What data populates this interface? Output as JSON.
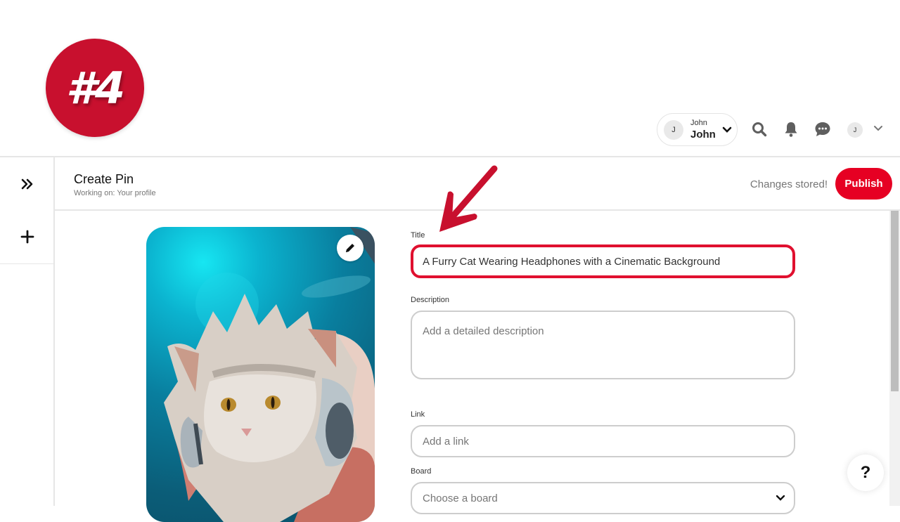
{
  "overlay": {
    "badge_text": "#4",
    "badge_color": "#c8102e",
    "arrow_color": "#c8102e"
  },
  "topbar": {
    "account": {
      "avatar_initial": "J",
      "name_small": "John",
      "name_large": "John"
    },
    "icons": [
      "search-icon",
      "bell-icon",
      "chat-icon"
    ],
    "profile_avatar_initial": "J"
  },
  "sidebar": {
    "items": [
      {
        "icon": "expand-icon",
        "label": "»"
      },
      {
        "icon": "plus-icon",
        "label": "+"
      }
    ]
  },
  "header": {
    "title": "Create Pin",
    "subtitle": "Working on: Your profile",
    "status": "Changes stored!",
    "publish_label": "Publish",
    "accent": "#e60023"
  },
  "form": {
    "title": {
      "label": "Title",
      "value": "A Furry Cat Wearing Headphones with a Cinematic Background"
    },
    "description": {
      "label": "Description",
      "placeholder": "Add a detailed description"
    },
    "link": {
      "label": "Link",
      "placeholder": "Add a link"
    },
    "board": {
      "label": "Board",
      "placeholder": "Choose a board"
    }
  },
  "image": {
    "alt": "Fluffy cat wearing headphones on a teal cinematic background"
  },
  "help": {
    "label": "?"
  }
}
